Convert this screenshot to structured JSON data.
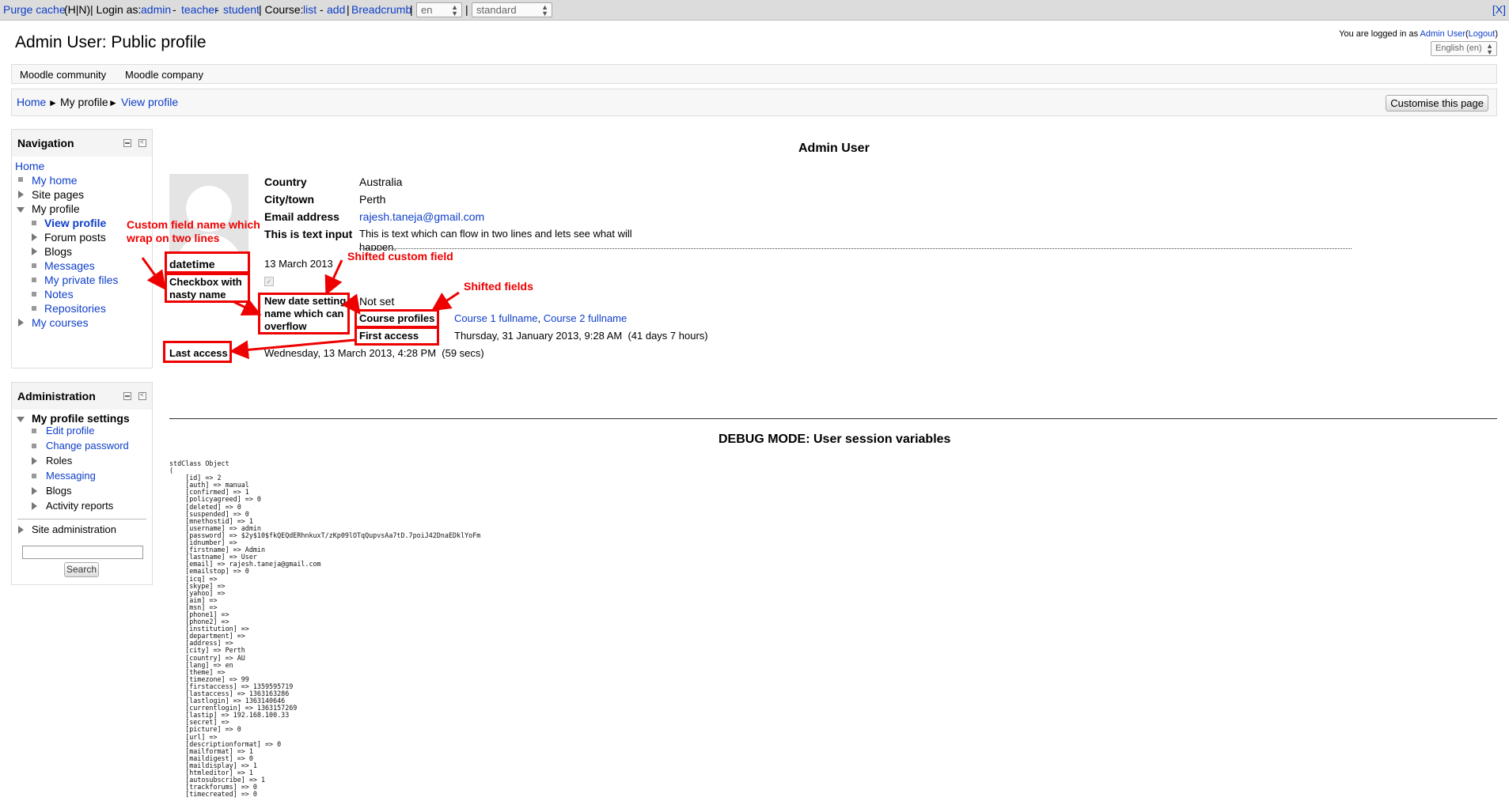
{
  "devbar": {
    "purge": "Purge cache",
    "hn": "(H|N)",
    "loginas_label": "| Login as:",
    "admin": "admin",
    "sep1": "-",
    "teacher": "teacher",
    "sep2": "-",
    "student": "student",
    "course_label": "| Course:",
    "list": "list",
    "sep3": "-",
    "add": "add",
    "sep4": "|",
    "breadcrumb": "Breadcrumb",
    "sep5": "|",
    "lang_value": "en",
    "sep6": "|",
    "theme_value": "standard",
    "close": "[X]"
  },
  "header": {
    "title": "Admin User: Public profile",
    "logged_in_prefix": "You are logged in as",
    "user_link": "Admin User",
    "logout_open": "(",
    "logout": "Logout",
    "logout_close": ")",
    "lang_select": "English (en)"
  },
  "custommenu": {
    "items": [
      "Moodle community",
      "Moodle company"
    ]
  },
  "navbar": {
    "home": "Home",
    "sep": "►",
    "my_profile": "My profile",
    "view_profile": "View profile",
    "customise": "Customise this page"
  },
  "navigation": {
    "title": "Navigation",
    "home": "Home",
    "my_home": "My home",
    "site_pages": "Site pages",
    "my_profile": "My profile",
    "view_profile": "View profile",
    "forum_posts": "Forum posts",
    "blogs": "Blogs",
    "messages": "Messages",
    "my_private_files": "My private files",
    "notes": "Notes",
    "repositories": "Repositories",
    "my_courses": "My courses"
  },
  "administration": {
    "title": "Administration",
    "my_profile_settings": "My profile settings",
    "edit_profile": "Edit profile",
    "change_password": "Change password",
    "roles": "Roles",
    "messaging": "Messaging",
    "blogs": "Blogs",
    "activity_reports": "Activity reports",
    "site_administration": "Site administration",
    "search_value": "",
    "search_button": "Search"
  },
  "profile": {
    "name": "Admin User",
    "country_label": "Country",
    "country": "Australia",
    "city_label": "City/town",
    "city": "Perth",
    "email_label": "Email address",
    "email": "rajesh.taneja@gmail.com",
    "text_input_label": "This is text input",
    "text_input_line1": "This is text which can flow in two lines and lets see what will",
    "text_input_line2": "happen.",
    "datetime_label": "datetime",
    "datetime": "13 March 2013",
    "checkbox_label_line1": "Checkbox with",
    "checkbox_label_line2": "nasty name",
    "new_date_label_line1": "New date setting",
    "new_date_label_line2": "name which can",
    "new_date_label_line3": "overflow",
    "new_date": "Not set",
    "course_profiles_label": "Course profiles",
    "course1": "Course 1 fullname",
    "course_sep": ", ",
    "course2": "Course 2 fullname",
    "first_access_label": "First access",
    "first_access": "Thursday, 31 January 2013, 9:28 AM  (41 days 7 hours)",
    "last_access_label": "Last access",
    "last_access": "Wednesday, 13 March 2013, 4:28 PM  (59 secs)"
  },
  "annotations": {
    "custom_field_line1": "Custom field name which",
    "custom_field_line2": "wrap on two lines",
    "shifted_custom_field": "Shifted custom field",
    "shifted_fields": "Shifted fields"
  },
  "debug": {
    "title": "DEBUG MODE: User session variables",
    "dump": "stdClass Object\n(\n    [id] => 2\n    [auth] => manual\n    [confirmed] => 1\n    [policyagreed] => 0\n    [deleted] => 0\n    [suspended] => 0\n    [mnethostid] => 1\n    [username] => admin\n    [password] => $2y$10$fkQEQdERhnkuxT/zKp09lOTqQupvsAa7tD.7poiJ42DnaEDklYoFm\n    [idnumber] =>\n    [firstname] => Admin\n    [lastname] => User\n    [email] => rajesh.taneja@gmail.com\n    [emailstop] => 0\n    [icq] =>\n    [skype] =>\n    [yahoo] =>\n    [aim] =>\n    [msn] =>\n    [phone1] =>\n    [phone2] =>\n    [institution] =>\n    [department] =>\n    [address] =>\n    [city] => Perth\n    [country] => AU\n    [lang] => en\n    [theme] =>\n    [timezone] => 99\n    [firstaccess] => 1359595719\n    [lastaccess] => 1363163286\n    [lastlogin] => 1363140646\n    [currentlogin] => 1363157269\n    [lastip] => 192.168.100.33\n    [secret] =>\n    [picture] => 0\n    [url] =>\n    [descriptionformat] => 0\n    [mailformat] => 1\n    [maildigest] => 0\n    [maildisplay] => 1\n    [htmleditor] => 1\n    [autosubscribe] => 1\n    [trackforums] => 0\n    [timecreated] => 0"
  },
  "colors": {
    "link": "#0e3ec8",
    "annotation": "#ee0000",
    "toolbar": "#dcdcdc"
  }
}
